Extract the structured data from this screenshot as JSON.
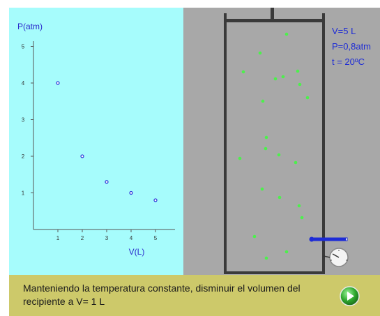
{
  "chart_data": {
    "type": "scatter",
    "ylabel": "P(atm)",
    "xlabel": "V(L)",
    "xlim": [
      0,
      5.3
    ],
    "ylim": [
      0,
      5.2
    ],
    "xticks": [
      1,
      2,
      3,
      4,
      5
    ],
    "yticks": [
      1,
      2,
      3,
      4,
      5
    ],
    "points": [
      {
        "x": 1,
        "y": 4.0
      },
      {
        "x": 2,
        "y": 2.0
      },
      {
        "x": 3,
        "y": 1.3
      },
      {
        "x": 4,
        "y": 1.0
      },
      {
        "x": 5,
        "y": 0.8
      }
    ],
    "marker_color": "#2a36d8",
    "grid": false
  },
  "readouts": {
    "volume": "V=5 L",
    "pressure": "P=0,8atm",
    "temperature": "t = 20ºC"
  },
  "instruction": "Manteniendo la temperatura constante, disminuir el volumen del recipiente a  V= 1 L",
  "colors": {
    "chart_bg": "#a6fcfc",
    "sim_bg": "#a8a8a8",
    "bar_bg": "#cdc96a",
    "particle": "#4cf04c",
    "readout": "#1d2bd6",
    "play_button": "#2fa82f"
  },
  "icons": {
    "play": "play-arrow-icon",
    "thermometer": "thermometer-icon",
    "gauge": "pressure-gauge-icon"
  }
}
